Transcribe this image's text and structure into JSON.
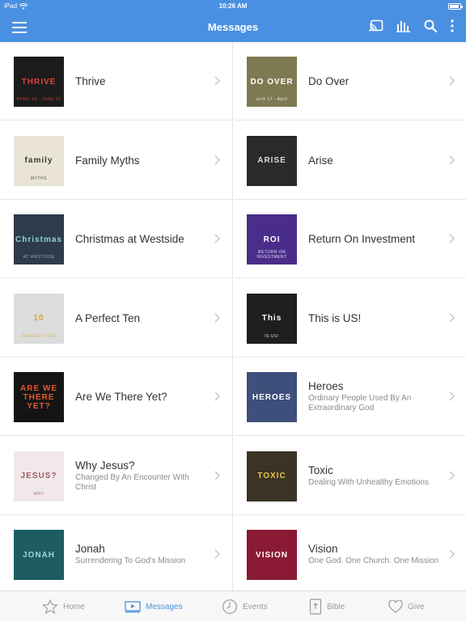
{
  "status": {
    "device": "iPad",
    "time": "10:26 AM"
  },
  "nav": {
    "title": "Messages",
    "icons": [
      "hamburger-menu-icon",
      "cast-icon",
      "audio-bars-icon",
      "search-icon",
      "more-vertical-icon"
    ]
  },
  "colors": {
    "accent": "#4a90e2",
    "inactive": "#999999",
    "divider": "#e6e6e6"
  },
  "messages": [
    {
      "title": "Thrive",
      "subtitle": "",
      "thumb_text": "THRIVE",
      "thumb_caption": "APRIL 28 - JUNE 16",
      "thumb_bg": "#1c1c1c",
      "thumb_fg": "#e0443a"
    },
    {
      "title": "Do Over",
      "subtitle": "",
      "thumb_text": "DO OVER",
      "thumb_caption": "arch 17 - April",
      "thumb_bg": "#7d7a52",
      "thumb_fg": "#ffffff"
    },
    {
      "title": "Family Myths",
      "subtitle": "",
      "thumb_text": "family",
      "thumb_caption": "MYTHS",
      "thumb_bg": "#e9e4d6",
      "thumb_fg": "#3b3b3b"
    },
    {
      "title": "Arise",
      "subtitle": "",
      "thumb_text": "ARISE",
      "thumb_caption": "",
      "thumb_bg": "#2a2a2a",
      "thumb_fg": "#d9d9d9"
    },
    {
      "title": "Christmas at Westside",
      "subtitle": "",
      "thumb_text": "Christmas",
      "thumb_caption": "AT WESTSIDE",
      "thumb_bg": "#2e3b4a",
      "thumb_fg": "#8fd3c8"
    },
    {
      "title": "Return On Investment",
      "subtitle": "",
      "thumb_text": "ROI",
      "thumb_caption": "RETURN ON INVESTMENT",
      "thumb_bg": "#4a2c8a",
      "thumb_fg": "#ffffff"
    },
    {
      "title": "A Perfect Ten",
      "subtitle": "",
      "thumb_text": "10",
      "thumb_caption": "PERFECT TEN",
      "thumb_bg": "#dcdcdc",
      "thumb_fg": "#d8a540"
    },
    {
      "title": "This is US!",
      "subtitle": "",
      "thumb_text": "This",
      "thumb_caption": "IS US!",
      "thumb_bg": "#1e1e1e",
      "thumb_fg": "#ffffff"
    },
    {
      "title": "Are We There Yet?",
      "subtitle": "",
      "thumb_text": "ARE WE THERE YET?",
      "thumb_caption": "",
      "thumb_bg": "#141414",
      "thumb_fg": "#e45a2c"
    },
    {
      "title": "Heroes",
      "subtitle": "Ordinary People Used By An Extraordinary God",
      "thumb_text": "HEROES",
      "thumb_caption": "",
      "thumb_bg": "#3d4f7a",
      "thumb_fg": "#ffffff"
    },
    {
      "title": "Why Jesus?",
      "subtitle": "Changed By An Encounter With Christ",
      "thumb_text": "JESUS?",
      "thumb_caption": "WHY",
      "thumb_bg": "#f1e8ea",
      "thumb_fg": "#a05a6a"
    },
    {
      "title": "Toxic",
      "subtitle": "Dealing With Unhealthy Emotions",
      "thumb_text": "TOXIC",
      "thumb_caption": "",
      "thumb_bg": "#3a3424",
      "thumb_fg": "#e8c84a"
    },
    {
      "title": "Jonah",
      "subtitle": "Surrendering To God's Mission",
      "thumb_text": "JONAH",
      "thumb_caption": "",
      "thumb_bg": "#1d5c63",
      "thumb_fg": "#9fd8d8"
    },
    {
      "title": "Vision",
      "subtitle": "One God. One Church. One Mission",
      "thumb_text": "VISION",
      "thumb_caption": "",
      "thumb_bg": "#8a1a33",
      "thumb_fg": "#ffffff"
    }
  ],
  "tabs": [
    {
      "label": "Home",
      "icon": "star-icon",
      "active": false
    },
    {
      "label": "Messages",
      "icon": "play-video-icon",
      "active": true
    },
    {
      "label": "Events",
      "icon": "clock-icon",
      "active": false
    },
    {
      "label": "Bible",
      "icon": "bible-icon",
      "active": false
    },
    {
      "label": "Give",
      "icon": "heart-icon",
      "active": false
    }
  ]
}
